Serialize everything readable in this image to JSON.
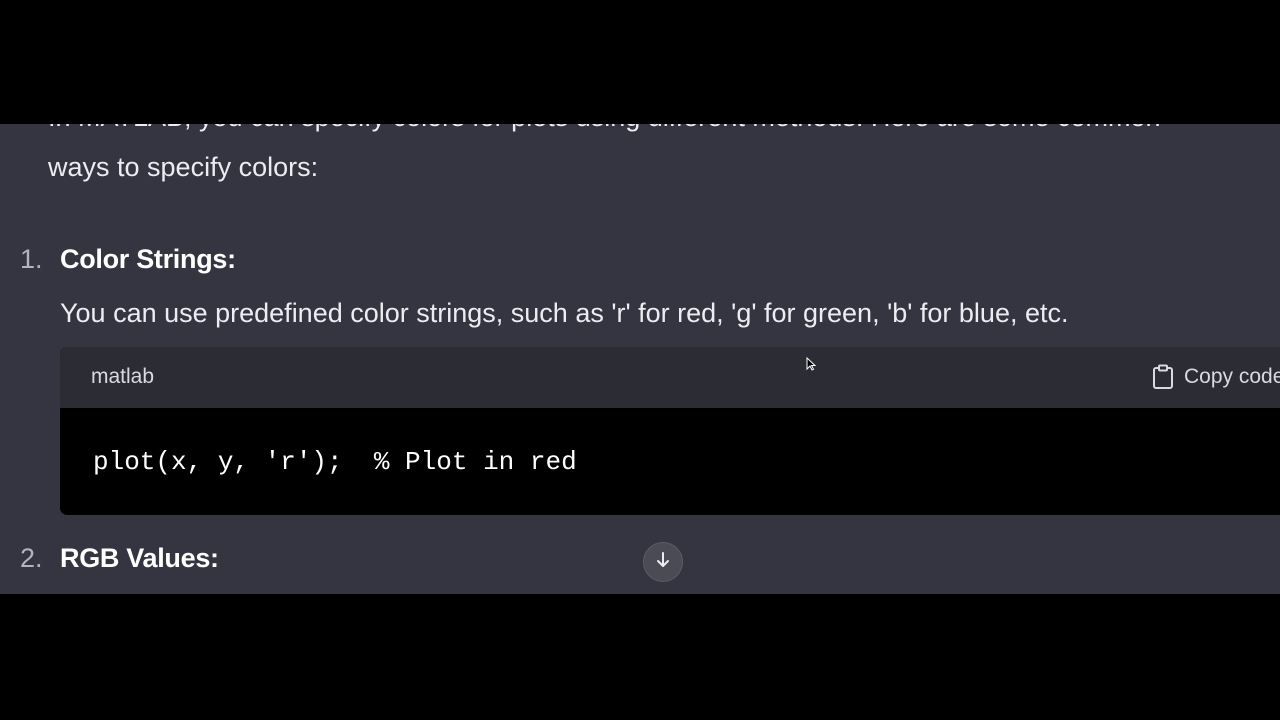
{
  "intro": {
    "line1": "In MATLAB, you can specify colors for plots using different methods. Here are some common",
    "line2": "ways to specify colors:"
  },
  "items": [
    {
      "number": "1.",
      "heading": "Color Strings:",
      "description": "You can use predefined color strings, such as 'r' for red, 'g' for green, 'b' for blue, etc.",
      "code": {
        "language": "matlab",
        "copy_label": "Copy code",
        "content": "plot(x, y, 'r');  % Plot in red"
      }
    },
    {
      "number": "2.",
      "heading": "RGB Values:"
    }
  ],
  "icons": {
    "copy": "clipboard-icon",
    "scroll": "arrow-down-icon",
    "pointer": "mouse-cursor-icon"
  },
  "colors": {
    "chat_background": "#343541",
    "code_header": "#2b2c34",
    "code_background": "#000000",
    "text": "#ececf1"
  }
}
